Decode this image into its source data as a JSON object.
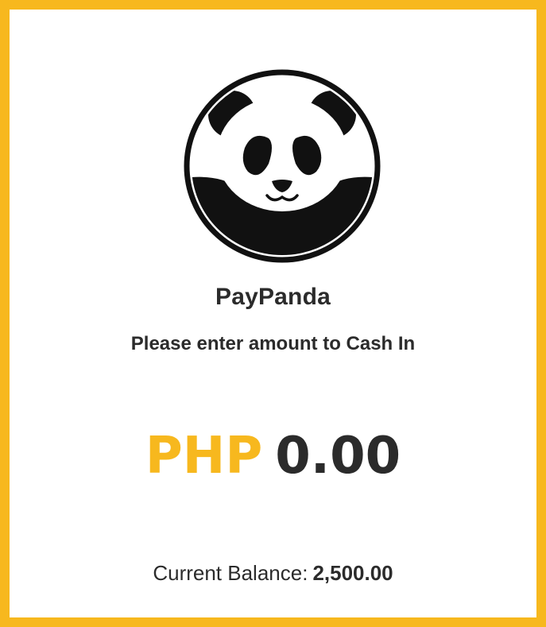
{
  "app": {
    "name": "PayPanda",
    "logo_icon": "panda-logo-icon"
  },
  "cash_in": {
    "instruction": "Please enter amount to Cash In",
    "currency": "PHP",
    "amount": "0.00"
  },
  "balance": {
    "label": "Current Balance:",
    "value": "2,500.00"
  },
  "colors": {
    "accent": "#F7B81E",
    "text": "#2B2B2B",
    "background": "#FFFFFF"
  }
}
